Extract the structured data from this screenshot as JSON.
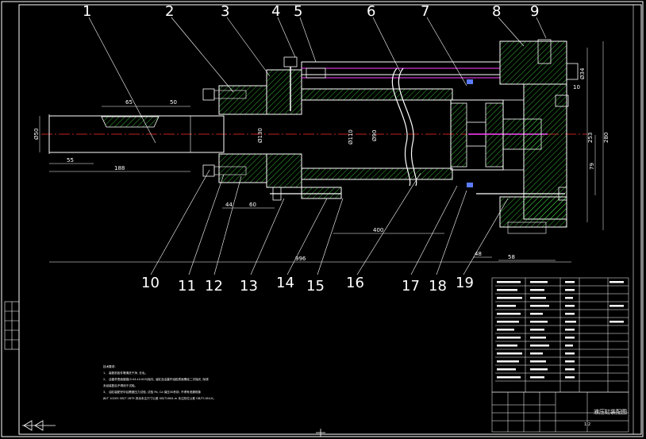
{
  "colors": {
    "background": "#000000",
    "lines": "#ffffff",
    "hatch": "#4cff4c",
    "centerline": "#ff2a2a",
    "highlight": "#ff40ff",
    "accent_blue": "#5a7cff"
  },
  "part_numbers_top": [
    "1",
    "2",
    "3",
    "4",
    "5",
    "6",
    "7",
    "8",
    "9"
  ],
  "part_numbers_bottom": [
    "10",
    "11",
    "12",
    "13",
    "14",
    "15",
    "16",
    "17",
    "18",
    "19"
  ],
  "dimensions": {
    "d65": "65",
    "d50": "50",
    "phi50": "Ø50",
    "d55": "55",
    "d188": "188",
    "phi130": "Ø130",
    "phi110": "Ø110",
    "phi90": "Ø90",
    "d60": "60",
    "d44": "44",
    "d400": "400",
    "d996": "996",
    "d79": "79",
    "d280": "280",
    "d253": "253",
    "d48": "48",
    "d58": "58",
    "d10": "10",
    "phi34": "Ø34"
  },
  "notes": {
    "heading": "技术要求:",
    "lines": [
      "1、 装配前各件需清洗干净, 去毛。",
      "2、 活塞杆表面镀铬(0.04±0.005)抛光, 油缸及活塞杆油腔表面需经二次抛光, 除锈",
      "   未经装配后不得用于试验。",
      "3、 油缸装配完毕后需做压力试验, 试验 Pa, Ca 保压30秒钟, 不得有泄漏现象",
      "JB/T 10205 GB/T 2879 其余未注尺寸公差 GB/T1804-m 未注形位公差 GB/T1184-K。"
    ]
  },
  "title_block": {
    "title": "液压缸装配图",
    "scale": "1:2"
  }
}
